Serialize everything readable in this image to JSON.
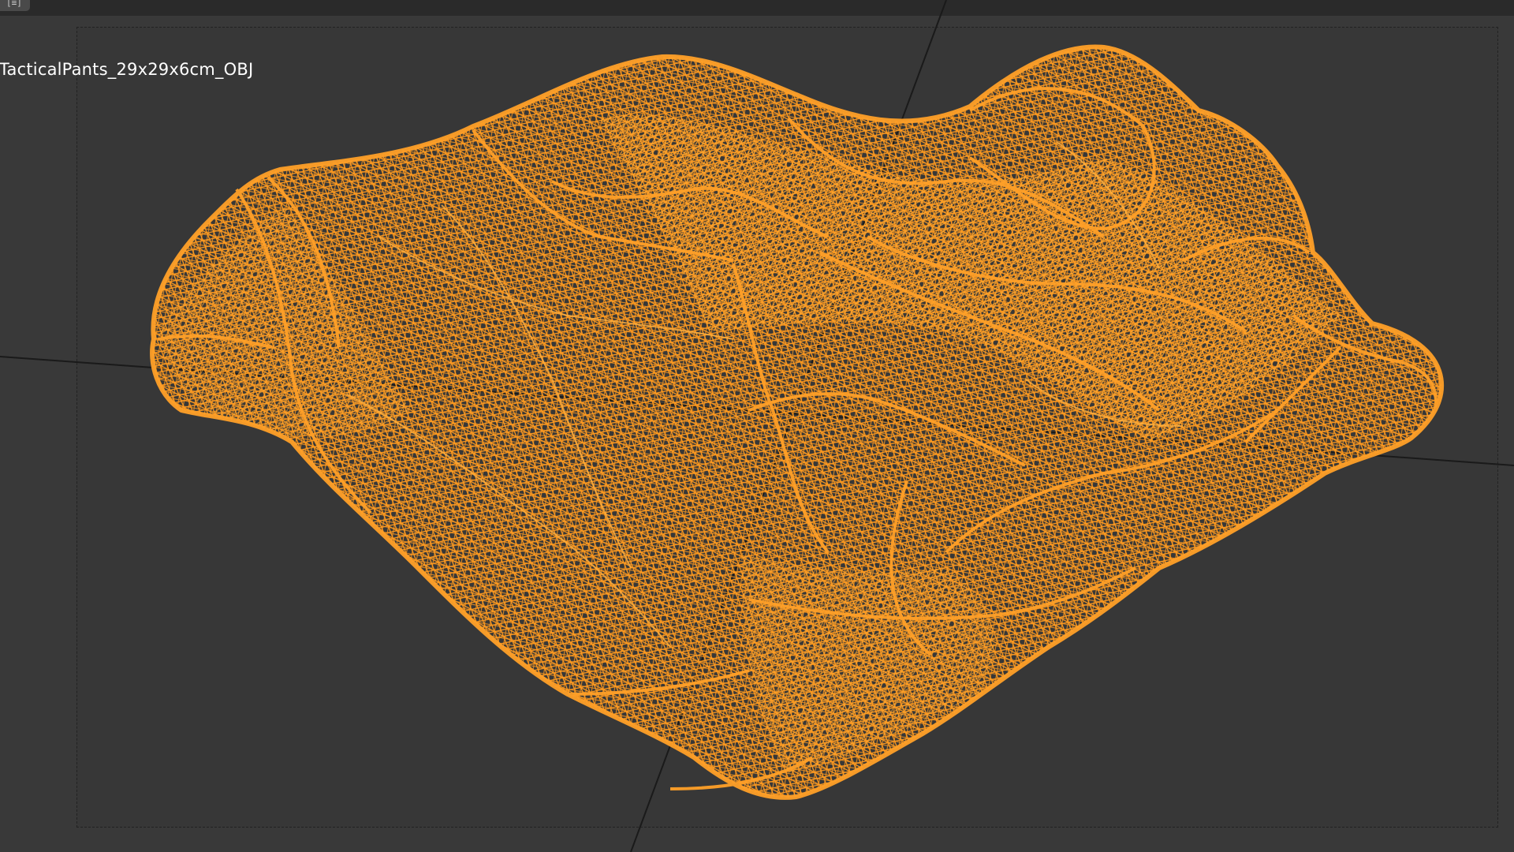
{
  "viewport": {
    "object_name": "TacticalPants_29x29x6cm_OBJ",
    "display_mode": "wireframe",
    "corner_widget_icon": "editor-type-icon",
    "colors": {
      "background": "#393939",
      "camera_frame": "#373737",
      "wireframe": "#ff9a1f",
      "axis_lines": "#1a1a1a",
      "label_text": "#ffffff"
    }
  }
}
